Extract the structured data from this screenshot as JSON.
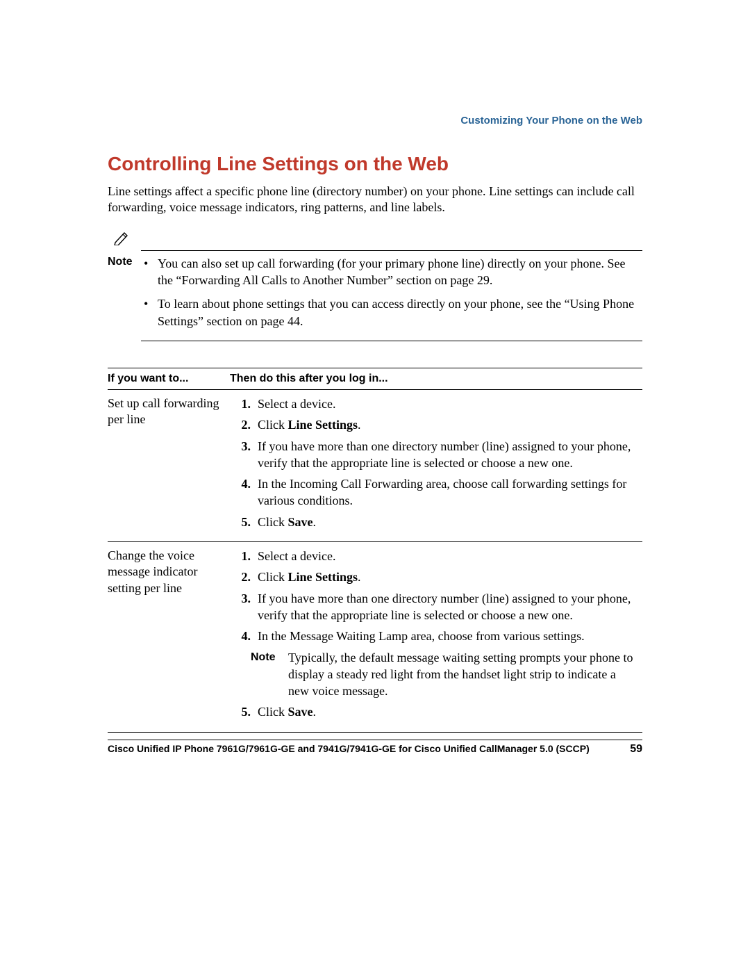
{
  "header": {
    "running": "Customizing Your Phone on the Web"
  },
  "section": {
    "title": "Controlling Line Settings on the Web",
    "intro": "Line settings affect a specific phone line (directory number) on your phone. Line settings can include call forwarding, voice message indicators, ring patterns, and line labels."
  },
  "note": {
    "label": "Note",
    "items": [
      "You can also set up call forwarding (for your primary phone line) directly on your phone. See the “Forwarding All Calls to Another Number” section on page 29.",
      "To learn about phone settings that you can access directly on your phone, see the “Using Phone Settings” section on page 44."
    ]
  },
  "table": {
    "headers": {
      "left": "If you want to...",
      "right": "Then do this after you log in..."
    },
    "rows": [
      {
        "task": "Set up call forwarding per line",
        "steps": [
          {
            "n": "1.",
            "pre": "Select a device."
          },
          {
            "n": "2.",
            "pre": "Click ",
            "bold": "Line Settings",
            "post": "."
          },
          {
            "n": "3.",
            "pre": "If you have more than one directory number (line) assigned to your phone, verify that the appropriate line is selected or choose a new one."
          },
          {
            "n": "4.",
            "pre": "In the Incoming Call Forwarding area, choose call forwarding settings for various conditions."
          },
          {
            "n": "5.",
            "pre": "Click ",
            "bold": "Save",
            "post": "."
          }
        ]
      },
      {
        "task": "Change the voice message indicator setting per line",
        "steps": [
          {
            "n": "1.",
            "pre": "Select a device."
          },
          {
            "n": "2.",
            "pre": "Click ",
            "bold": "Line Settings",
            "post": "."
          },
          {
            "n": "3.",
            "pre": "If you have more than one directory number (line) assigned to your phone, verify that the appropriate line is selected or choose a new one."
          },
          {
            "n": "4.",
            "pre": "In the Message Waiting Lamp area, choose from various settings."
          },
          {
            "note": {
              "label": "Note",
              "text": "Typically, the default message waiting setting prompts your phone to display a steady red light from the handset light strip to indicate a new voice message."
            }
          },
          {
            "n": "5.",
            "pre": "Click ",
            "bold": "Save",
            "post": "."
          }
        ]
      }
    ]
  },
  "footer": {
    "title": "Cisco Unified IP Phone 7961G/7961G-GE and 7941G/7941G-GE for Cisco Unified CallManager 5.0 (SCCP)",
    "page": "59"
  }
}
